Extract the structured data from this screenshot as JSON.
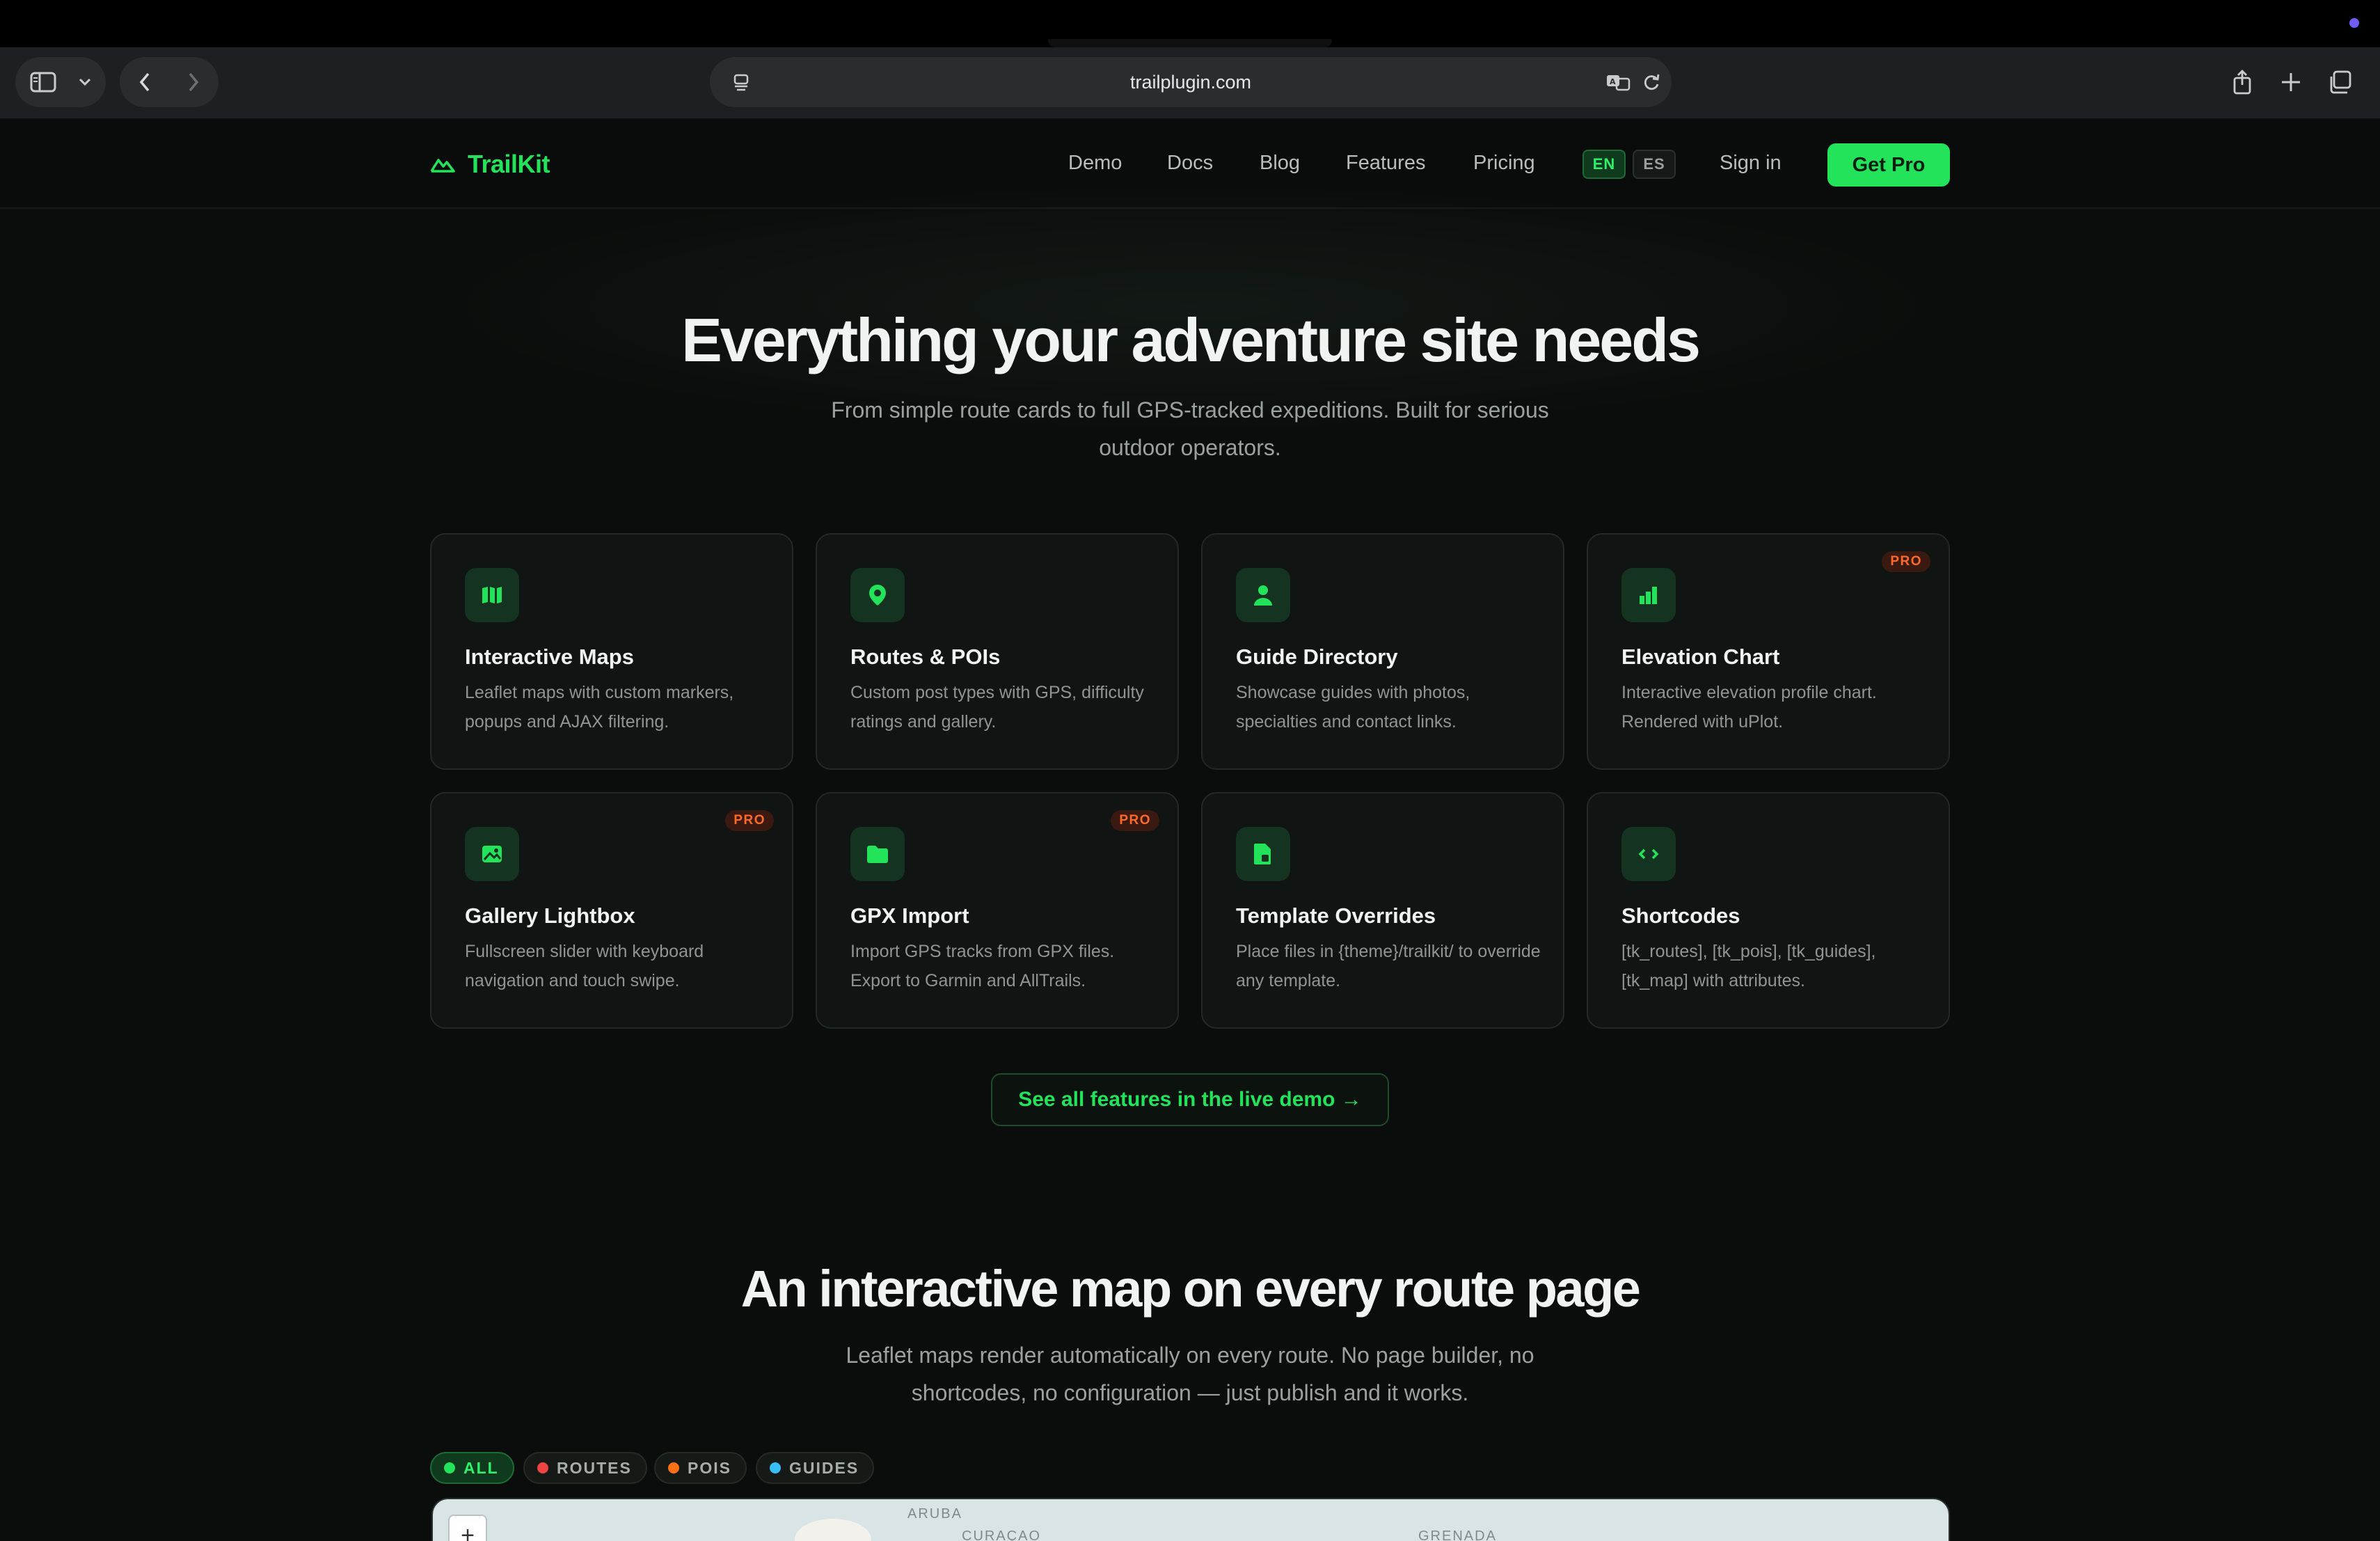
{
  "browser": {
    "url": "trailplugin.com"
  },
  "nav": {
    "brand": "TrailKit",
    "links": [
      "Demo",
      "Docs",
      "Blog",
      "Features",
      "Pricing"
    ],
    "lang_active": "EN",
    "lang_inactive": "ES",
    "sign_in": "Sign in",
    "cta": "Get Pro"
  },
  "hero": {
    "title": "Everything your adventure site needs",
    "subtitle": "From simple route cards to full GPS-tracked expeditions. Built for serious outdoor operators."
  },
  "features": [
    {
      "title": "Interactive Maps",
      "desc": "Leaflet maps with custom markers, popups and AJAX filtering.",
      "badge": "",
      "icon": "map-icon"
    },
    {
      "title": "Routes & POIs",
      "desc": "Custom post types with GPS, difficulty ratings and gallery.",
      "badge": "",
      "icon": "map-pin-icon"
    },
    {
      "title": "Guide Directory",
      "desc": "Showcase guides with photos, specialties and contact links.",
      "badge": "",
      "icon": "person-icon"
    },
    {
      "title": "Elevation Chart",
      "desc": "Interactive elevation profile chart. Rendered with uPlot.",
      "badge": "PRO",
      "icon": "bar-chart-icon"
    },
    {
      "title": "Gallery Lightbox",
      "desc": "Fullscreen slider with keyboard navigation and touch swipe.",
      "badge": "PRO",
      "icon": "image-icon"
    },
    {
      "title": "GPX Import",
      "desc": "Import GPS tracks from GPX files. Export to Garmin and AllTrails.",
      "badge": "PRO",
      "icon": "folder-icon"
    },
    {
      "title": "Template Overrides",
      "desc": "Place files in {theme}/trailkit/ to override any template.",
      "badge": "",
      "icon": "file-icon"
    },
    {
      "title": "Shortcodes",
      "desc": "[tk_routes], [tk_pois], [tk_guides], [tk_map] with attributes.",
      "badge": "",
      "icon": "code-icon"
    }
  ],
  "demo_link": "See all features in the live demo →",
  "map_section": {
    "title": "An interactive map on every route page",
    "subtitle": "Leaflet maps render automatically on every route. No page builder, no shortcodes, no configuration — just publish and it works.",
    "filters": [
      {
        "label": "ALL",
        "color": "#22e35a",
        "active": true
      },
      {
        "label": "ROUTES",
        "color": "#ef4444",
        "active": false
      },
      {
        "label": "POIS",
        "color": "#f97316",
        "active": false
      },
      {
        "label": "GUIDES",
        "color": "#38bdf8",
        "active": false
      }
    ],
    "map_labels": [
      "ARUBA",
      "CURAÇAO",
      "GRENADA"
    ],
    "zoom_in": "+"
  },
  "colors": {
    "accent": "#22e35a",
    "pro_badge": "#ff6a2b",
    "background": "#0b0d0c"
  }
}
